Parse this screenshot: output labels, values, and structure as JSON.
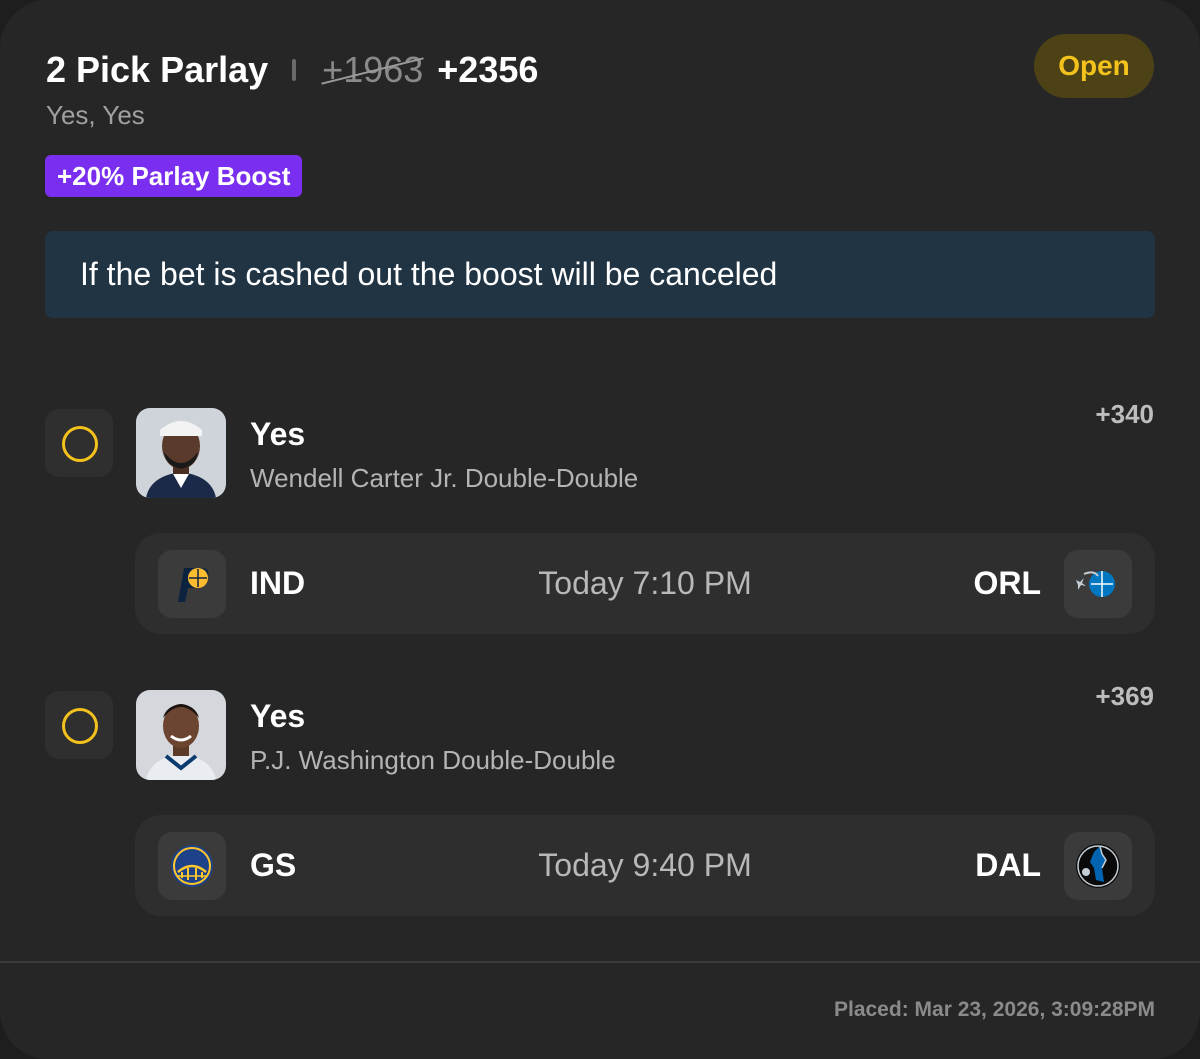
{
  "header": {
    "title": "2 Pick Parlay",
    "old_odds": "+1963",
    "new_odds": "+2356",
    "subtitle": "Yes, Yes",
    "boost_label": "+20% Parlay Boost",
    "status": "Open"
  },
  "notice": {
    "text": "If the bet is cashed out the boost will be canceled"
  },
  "picks": [
    {
      "selection": "Yes",
      "market": "Wendell Carter Jr. Double-Double",
      "odds": "+340",
      "game": {
        "away": "IND",
        "time": "Today 7:10 PM",
        "home": "ORL"
      }
    },
    {
      "selection": "Yes",
      "market": "P.J. Washington Double-Double",
      "odds": "+369",
      "game": {
        "away": "GS",
        "time": "Today 9:40 PM",
        "home": "DAL"
      }
    }
  ],
  "footer": {
    "placed": "Placed: Mar 23, 2026, 3:09:28PM"
  },
  "icons": {
    "pick_status": "empty-circle-icon",
    "player": "player-headshot-icon",
    "ind": "pacers-logo-icon",
    "orl": "magic-logo-icon",
    "gs": "warriors-logo-icon",
    "dal": "mavericks-logo-icon"
  },
  "colors": {
    "accent_yellow": "#f4c21c",
    "boost_purple": "#7a2ff0",
    "notice_bg": "#203444",
    "card_bg": "#262626"
  }
}
